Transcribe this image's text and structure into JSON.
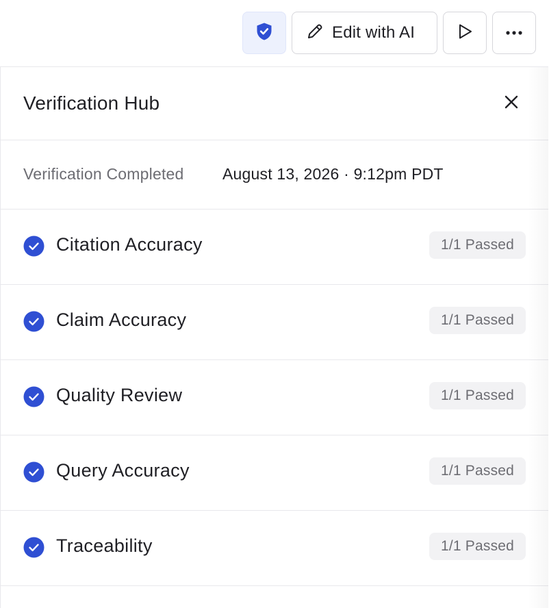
{
  "toolbar": {
    "shield_icon": "shield-check-icon",
    "edit_label": "Edit with AI",
    "edit_icon": "pencil-icon",
    "play_icon": "play-icon",
    "more_icon": "ellipsis-icon"
  },
  "panel": {
    "title": "Verification Hub",
    "close_icon": "close-icon",
    "status": {
      "label": "Verification Completed",
      "value": "August 13, 2026 · 9:12pm PDT"
    },
    "checks": [
      {
        "label": "Citation Accuracy",
        "status": "1/1 Passed",
        "icon": "check-circle-icon"
      },
      {
        "label": "Claim Accuracy",
        "status": "1/1 Passed",
        "icon": "check-circle-icon"
      },
      {
        "label": "Quality Review",
        "status": "1/1 Passed",
        "icon": "check-circle-icon"
      },
      {
        "label": "Query Accuracy",
        "status": "1/1 Passed",
        "icon": "check-circle-icon"
      },
      {
        "label": "Traceability",
        "status": "1/1 Passed",
        "icon": "check-circle-icon"
      }
    ]
  },
  "colors": {
    "accent": "#2f4fd3",
    "accent_bg": "#edf1fd",
    "badge_bg": "#f2f2f4",
    "muted_text": "#6d6d73"
  }
}
